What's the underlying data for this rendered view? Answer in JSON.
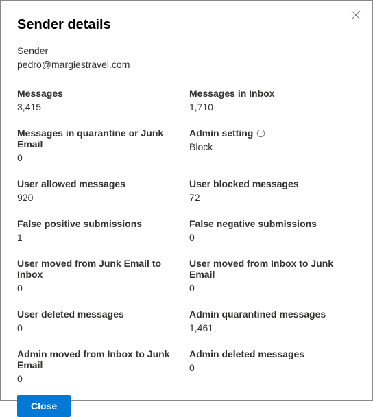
{
  "header": {
    "title": "Sender details"
  },
  "sender": {
    "label": "Sender",
    "value": "pedro@margiestravel.com"
  },
  "metrics": {
    "messages": {
      "label": "Messages",
      "value": "3,415"
    },
    "messages_in_inbox": {
      "label": "Messages in Inbox",
      "value": "1,710"
    },
    "messages_quarantine_junk": {
      "label": "Messages in quarantine or Junk Email",
      "value": "0"
    },
    "admin_setting": {
      "label": "Admin setting",
      "value": "Block"
    },
    "user_allowed": {
      "label": "User allowed messages",
      "value": "920"
    },
    "user_blocked": {
      "label": "User blocked messages",
      "value": "72"
    },
    "false_positive": {
      "label": "False positive submissions",
      "value": "1"
    },
    "false_negative": {
      "label": "False negative submissions",
      "value": "0"
    },
    "user_moved_junk_to_inbox": {
      "label": "User moved from Junk Email to Inbox",
      "value": "0"
    },
    "user_moved_inbox_to_junk": {
      "label": "User moved from Inbox to Junk Email",
      "value": "0"
    },
    "user_deleted": {
      "label": "User deleted messages",
      "value": "0"
    },
    "admin_quarantined": {
      "label": "Admin quarantined messages",
      "value": "1,461"
    },
    "admin_moved_inbox_to_junk": {
      "label": "Admin moved from Inbox to Junk Email",
      "value": "0"
    },
    "admin_deleted": {
      "label": "Admin deleted messages",
      "value": "0"
    }
  },
  "footer": {
    "close_label": "Close"
  }
}
